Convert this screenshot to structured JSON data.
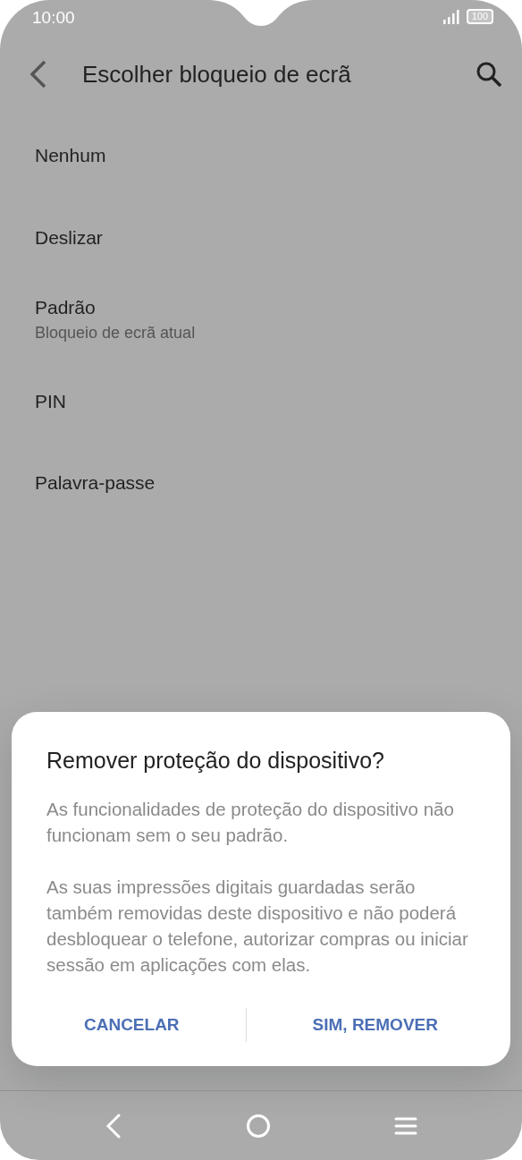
{
  "status_bar": {
    "time": "10:00",
    "battery": "100"
  },
  "header": {
    "title": "Escolher bloqueio de ecrã"
  },
  "options": [
    {
      "title": "Nenhum"
    },
    {
      "title": "Deslizar"
    },
    {
      "title": "Padrão",
      "subtitle": "Bloqueio de ecrã atual"
    },
    {
      "title": "PIN"
    },
    {
      "title": "Palavra-passe"
    }
  ],
  "dialog": {
    "title": "Remover proteção do dispositivo?",
    "paragraphs": [
      "As funcionalidades de proteção do dispositivo não funcionam sem o seu padrão.",
      "As suas impressões digitais guardadas serão também removidas deste dispositivo e não poderá desbloquear o telefone, autorizar compras ou iniciar sessão em aplicações com elas."
    ],
    "buttons": [
      "CANCELAR",
      "SIM, REMOVER"
    ]
  }
}
